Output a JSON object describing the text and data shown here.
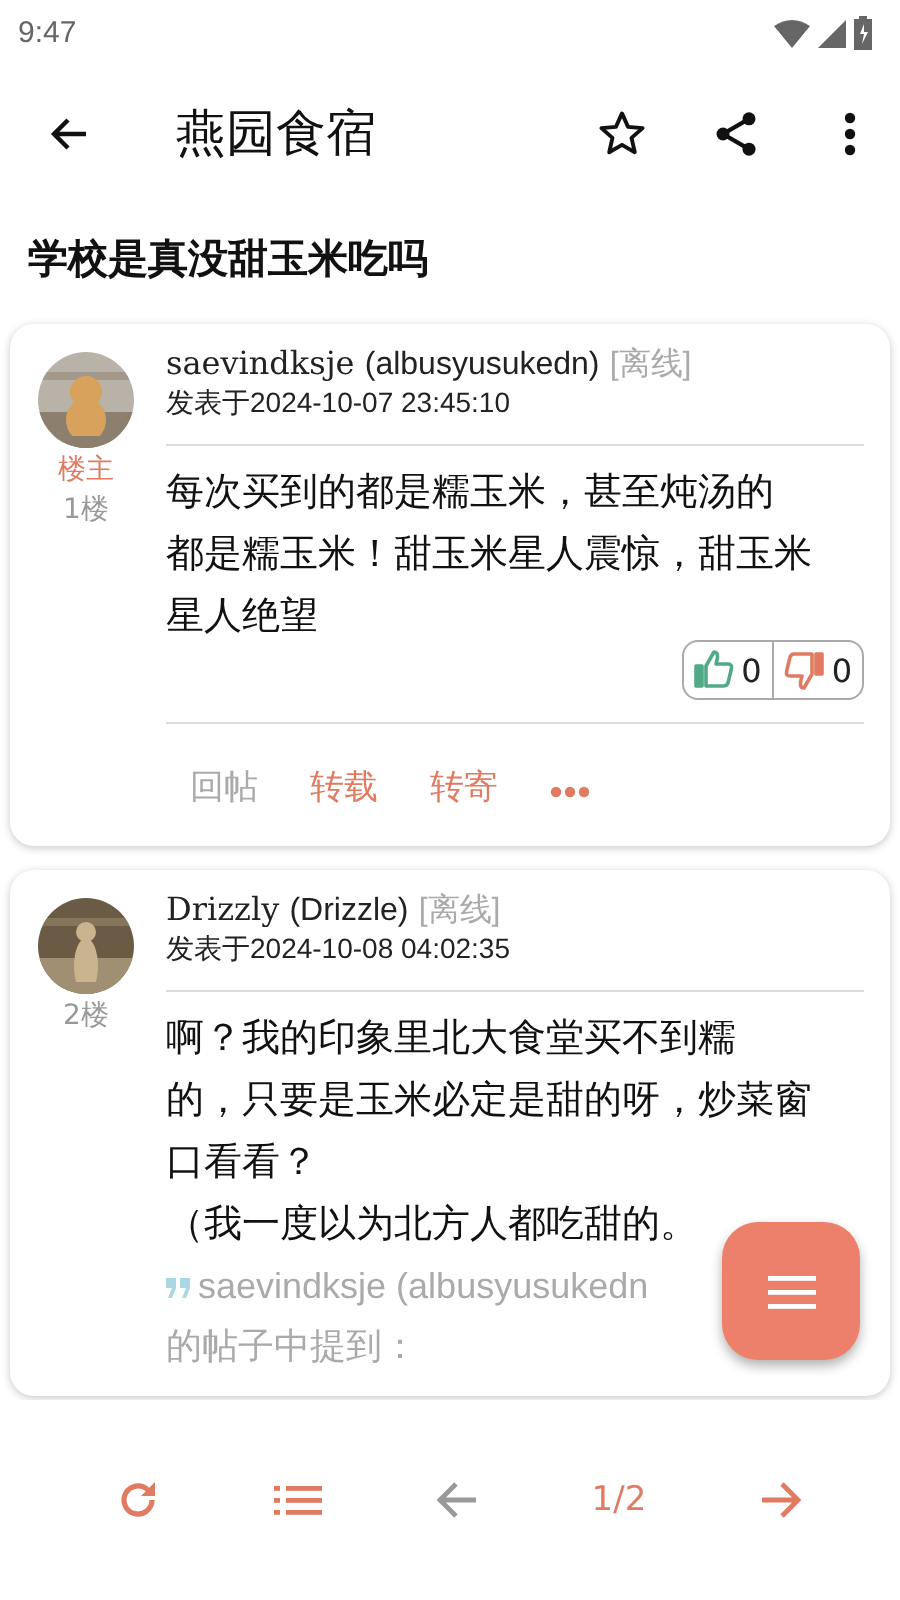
{
  "status_bar": {
    "time": "9:47"
  },
  "app_bar": {
    "title": "燕园食宿"
  },
  "thread": {
    "title": "学校是真没甜玉米吃吗"
  },
  "posts": [
    {
      "badge": "楼主",
      "floor": "1楼",
      "username": "saevindksje",
      "nickname": "(albusyusukedn)",
      "status": "[离线]",
      "date": "发表于2024-10-07 23:45:10",
      "body": [
        "每次买到的都是糯玉米，甚至炖汤的",
        "都是糯玉米！甜玉米星人震惊，甜玉米",
        "星人绝望"
      ],
      "votes": {
        "up": "0",
        "down": "0"
      },
      "actions": [
        {
          "label": "回帖",
          "disabled": true
        },
        {
          "label": "转载",
          "disabled": false
        },
        {
          "label": "转寄",
          "disabled": false
        }
      ]
    },
    {
      "floor": "2楼",
      "username": "Drizzly",
      "nickname": "(Drizzle)",
      "status": "[离线]",
      "date": "发表于2024-10-08 04:02:35",
      "body": [
        "啊？我的印象里北大食堂买不到糯",
        "的，只要是玉米必定是甜的呀，炒菜窗",
        "口看看？",
        "（我一度以为北方人都吃甜的。"
      ],
      "quote": {
        "author": "saevindksje (albusyusukedn",
        "intro": "的帖子中提到："
      }
    }
  ],
  "bottom_nav": {
    "page": "1/2",
    "prev_disabled": true,
    "next_disabled": false
  }
}
